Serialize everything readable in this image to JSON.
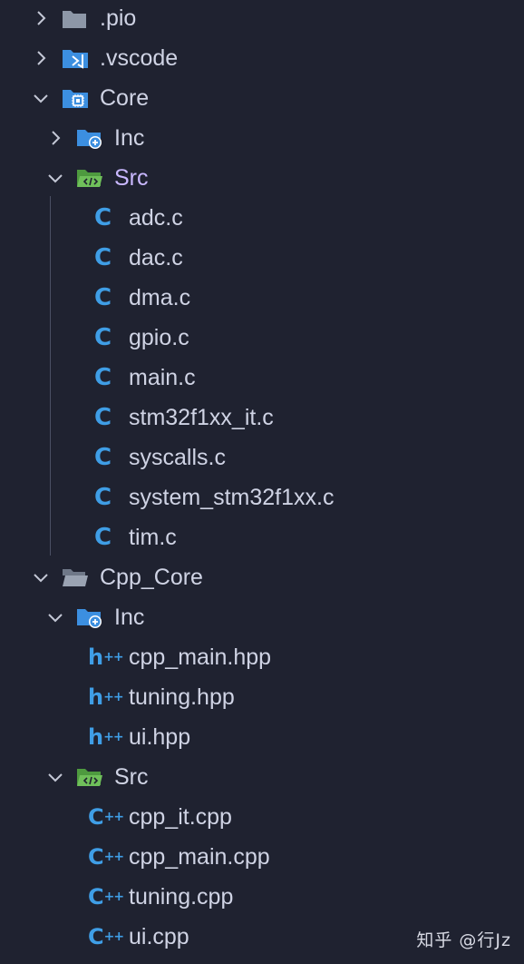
{
  "tree": {
    "pio": {
      "label": ".pio"
    },
    "vscode": {
      "label": ".vscode"
    },
    "core": {
      "label": "Core",
      "inc": {
        "label": "Inc"
      },
      "src": {
        "label": "Src",
        "files": [
          "adc.c",
          "dac.c",
          "dma.c",
          "gpio.c",
          "main.c",
          "stm32f1xx_it.c",
          "syscalls.c",
          "system_stm32f1xx.c",
          "tim.c"
        ]
      }
    },
    "cpp_core": {
      "label": "Cpp_Core",
      "inc": {
        "label": "Inc",
        "files": [
          "cpp_main.hpp",
          "tuning.hpp",
          "ui.hpp"
        ]
      },
      "src": {
        "label": "Src",
        "files": [
          "cpp_it.cpp",
          "cpp_main.cpp",
          "tuning.cpp",
          "ui.cpp"
        ]
      }
    }
  },
  "icons": {
    "c_file": "C",
    "hpp_file": "h++",
    "cpp_file": "C++"
  },
  "watermark": "知乎 @行Jz",
  "colors": {
    "background": "#1f2230",
    "text": "#cfd3e4",
    "active_text": "#c9b8ff",
    "file_icon": "#3f9ee6",
    "folder_gray": "#8d97a7",
    "folder_blue": "#3c8fe0",
    "folder_green": "#5aa94a"
  }
}
